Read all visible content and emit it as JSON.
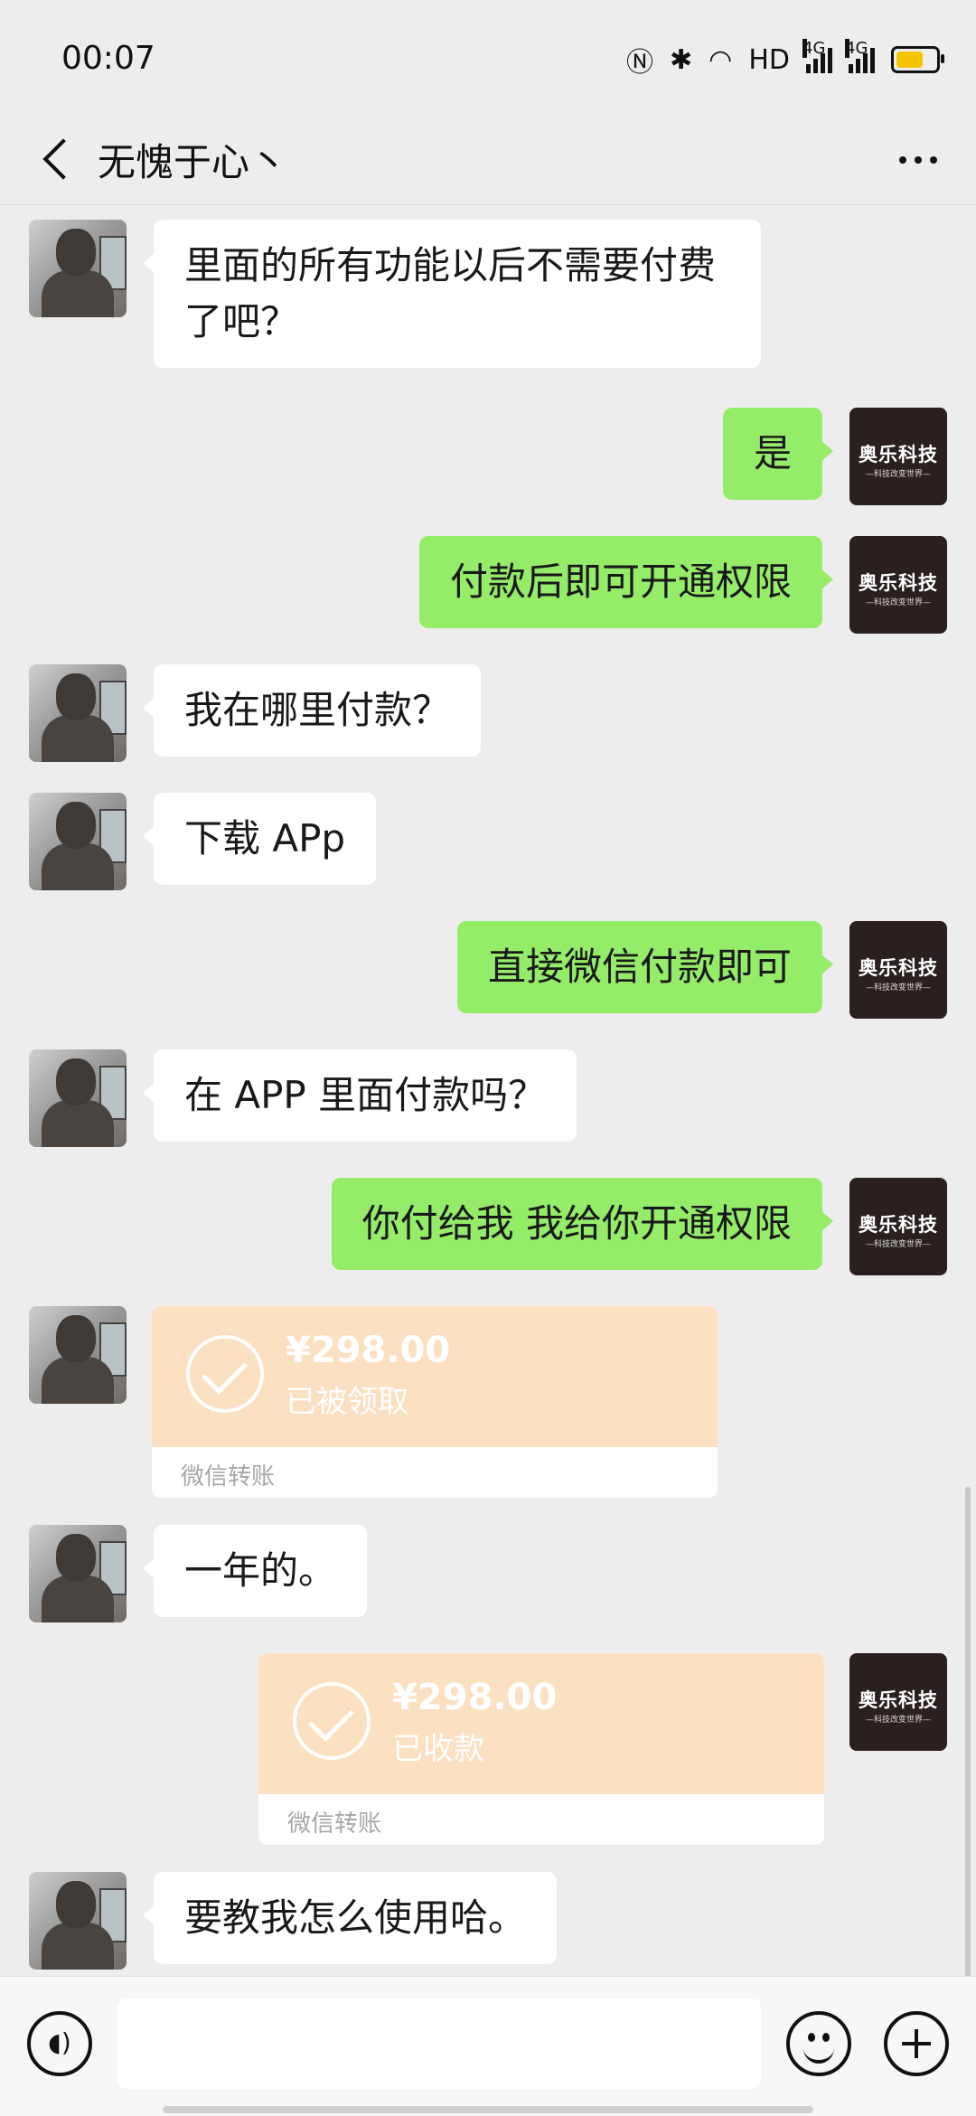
{
  "status_bar": {
    "time": "00:07",
    "network_hd": "HD",
    "sim1_label": "4G",
    "sim2_label": "4G",
    "battery_level": 0.7,
    "battery_color": "#f5c400"
  },
  "header": {
    "title": "无愧于心丶"
  },
  "my_avatar": {
    "name": "奥乐科技",
    "tagline": "—科技改变世界—"
  },
  "messages": [
    {
      "sender": "friend",
      "type": "text",
      "text": "里面的所有功能以后不需要付费了吧？"
    },
    {
      "sender": "me",
      "type": "text",
      "text": "是"
    },
    {
      "sender": "me",
      "type": "text",
      "text": "付款后即可开通权限"
    },
    {
      "sender": "friend",
      "type": "text",
      "text": "我在哪里付款？"
    },
    {
      "sender": "friend",
      "type": "text",
      "text": "下载 APp"
    },
    {
      "sender": "me",
      "type": "text",
      "text": "直接微信付款即可"
    },
    {
      "sender": "friend",
      "type": "text",
      "text": "在 APP 里面付款吗？"
    },
    {
      "sender": "me",
      "type": "text",
      "text": "你付给我 我给你开通权限"
    },
    {
      "sender": "friend",
      "type": "transfer",
      "amount": "¥298.00",
      "status": "已被领取",
      "footer": "微信转账"
    },
    {
      "sender": "friend",
      "type": "text",
      "text": "一年的。"
    },
    {
      "sender": "me",
      "type": "transfer",
      "amount": "¥298.00",
      "status": "已收款",
      "footer": "微信转账"
    },
    {
      "sender": "friend",
      "type": "text",
      "text": "要教我怎么使用哈。"
    }
  ],
  "input_bar": {
    "placeholder": ""
  },
  "colors": {
    "background": "#ededed",
    "my_bubble": "#95ec69",
    "friend_bubble": "#ffffff",
    "transfer": "#fce0c2"
  }
}
